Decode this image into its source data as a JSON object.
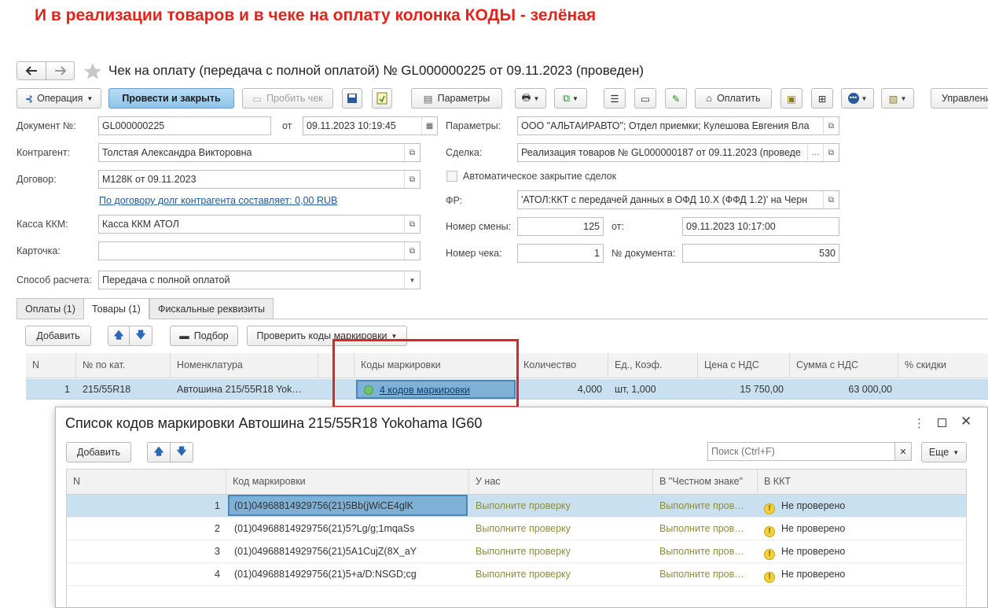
{
  "annotation": "И в реализации товаров и в чеке на оплату колонка КОДЫ - зелёная",
  "window": {
    "title": "Чек на оплату (передача с полной оплатой) № GL000000225 от 09.11.2023 (проведен)"
  },
  "toolbar": {
    "operation": "Операция",
    "post_close": "Провести и закрыть",
    "print_check": "Пробить чек",
    "params": "Параметры",
    "pay": "Оплатить",
    "manage": "Управлени"
  },
  "form": {
    "doc_no_label": "Документ №:",
    "doc_no": "GL000000225",
    "from_label": "от",
    "date": "09.11.2023 10:19:45",
    "counterparty_label": "Контрагент:",
    "counterparty": "Толстая Александра Викторовна",
    "contract_label": "Договор:",
    "contract": "М128К от 09.11.2023",
    "debt_link": "По договору долг контрагента составляет: 0,00 RUB",
    "kkm_label": "Касса ККМ:",
    "kkm": "Касса ККМ АТОЛ",
    "card_label": "Карточка:",
    "card": "",
    "payment_method_label": "Способ расчета:",
    "payment_method": "Передача с полной оплатой",
    "params_label": "Параметры:",
    "params": "ООО \"АЛЬТАИРАВТО\"; Отдел приемки; Кулешова Евгения Вла",
    "deal_label": "Сделка:",
    "deal": "Реализация товаров № GL000000187 от 09.11.2023 (проведе",
    "auto_close": "Автоматическое закрытие сделок",
    "fr_label": "ФР:",
    "fr": "'АТОЛ:ККТ с передачей данных в ОФД 10.X (ФФД 1.2)' на Черн",
    "shift_label": "Номер смены:",
    "shift": "125",
    "shift_from_label": "от:",
    "shift_date": "09.11.2023 10:17:00",
    "check_no_label": "Номер чека:",
    "check_no": "1",
    "doc_num_label": "№ документа:",
    "doc_num": "530"
  },
  "tabs": [
    "Оплаты (1)",
    "Товары (1)",
    "Фискальные реквизиты"
  ],
  "goods_toolbar": {
    "add": "Добавить",
    "pick": "Подбор",
    "check_codes": "Проверить коды маркировки"
  },
  "goods_table": {
    "headers": [
      "N",
      "№ по кат.",
      "Номенклатура",
      "Коды маркировки",
      "Количество",
      "Ед., Коэф.",
      "Цена с НДС",
      "Сумма с НДС",
      "% скидки"
    ],
    "row": {
      "n": "1",
      "cat": "215/55R18",
      "name": "Автошина 215/55R18 Yok…",
      "codes": "4 кодов маркировки",
      "qty": "4,000",
      "unit": "шт, 1,000",
      "price": "15 750,00",
      "sum": "63 000,00"
    }
  },
  "dialog": {
    "title": "Список кодов маркировки Автошина 215/55R18 Yokohama IG60",
    "add": "Добавить",
    "search_placeholder": "Поиск (Ctrl+F)",
    "more": "Еще",
    "headers": [
      "N",
      "Код маркировки",
      "У нас",
      "В \"Честном знаке\"",
      "В ККТ"
    ],
    "rows": [
      {
        "n": "1",
        "code": "(01)04968814929756(21)5Bb(jWiCE4glK",
        "us": "Выполните проверку",
        "cz": "Выполните пров…",
        "kkt": "Не проверено"
      },
      {
        "n": "2",
        "code": "(01)04968814929756(21)5?Lg/g;1mqaSs",
        "us": "Выполните проверку",
        "cz": "Выполните пров…",
        "kkt": "Не проверено"
      },
      {
        "n": "3",
        "code": "(01)04968814929756(21)5A1CujZ(8X_aY",
        "us": "Выполните проверку",
        "cz": "Выполните пров…",
        "kkt": "Не проверено"
      },
      {
        "n": "4",
        "code": "(01)04968814929756(21)5+a/D:NSGD;cg",
        "us": "Выполните проверку",
        "cz": "Выполните пров…",
        "kkt": "Не проверено"
      }
    ]
  },
  "colors": {
    "annotation": "#e2231a",
    "highlight_box": "#d9262e",
    "selected_row": "#c9e0f0",
    "selected_cell": "#7fb1d6",
    "status_green": "#6fc36b",
    "warn_yellow": "#f4d03f"
  }
}
